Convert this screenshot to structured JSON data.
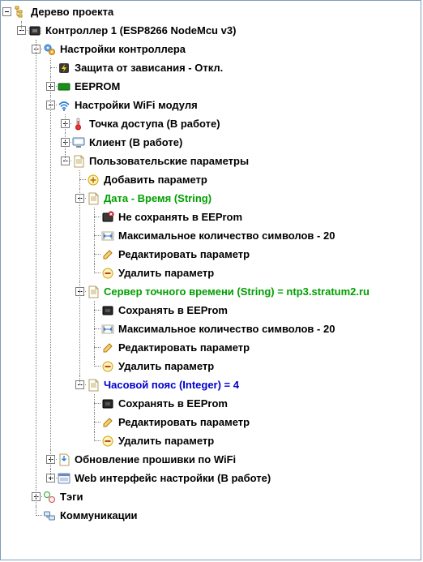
{
  "root": {
    "label": "Дерево проекта"
  },
  "controller": {
    "label": "Контроллер 1 (ESP8266 NodeMcu v3)"
  },
  "settings": {
    "label": "Настройки контроллера"
  },
  "watchdog": {
    "label": "Защита от зависания - Откл."
  },
  "eeprom": {
    "label": "EEPROM"
  },
  "wifi": {
    "label": "Настройки WiFi модуля"
  },
  "ap": {
    "label": "Точка доступа (В работе)"
  },
  "client": {
    "label": "Клиент (В работе)"
  },
  "userparams": {
    "label": "Пользовательские параметры"
  },
  "addparam": {
    "label": "Добавить параметр"
  },
  "p_datetime": {
    "label": "Дата - Время (String)"
  },
  "p_datetime_nosave": {
    "label": "Не сохранять в EEProm"
  },
  "p_datetime_max": {
    "label": "Максимальное количество символов - 20"
  },
  "p_datetime_edit": {
    "label": "Редактировать параметр"
  },
  "p_datetime_del": {
    "label": "Удалить параметр"
  },
  "p_ntp": {
    "label": "Сервер точного времени (String) = ntp3.stratum2.ru"
  },
  "p_ntp_save": {
    "label": "Сохранять в EEProm"
  },
  "p_ntp_max": {
    "label": "Максимальное количество символов - 20"
  },
  "p_ntp_edit": {
    "label": "Редактировать параметр"
  },
  "p_ntp_del": {
    "label": "Удалить параметр"
  },
  "p_tz": {
    "label": "Часовой пояс (Integer) = 4"
  },
  "p_tz_save": {
    "label": "Сохранять в EEProm"
  },
  "p_tz_edit": {
    "label": "Редактировать параметр"
  },
  "p_tz_del": {
    "label": "Удалить параметр"
  },
  "fw": {
    "label": "Обновление прошивки по WiFi"
  },
  "web": {
    "label": "Web интерфейс настройки (В работе)"
  },
  "tags": {
    "label": "Тэги"
  },
  "comm": {
    "label": "Коммуникации"
  }
}
